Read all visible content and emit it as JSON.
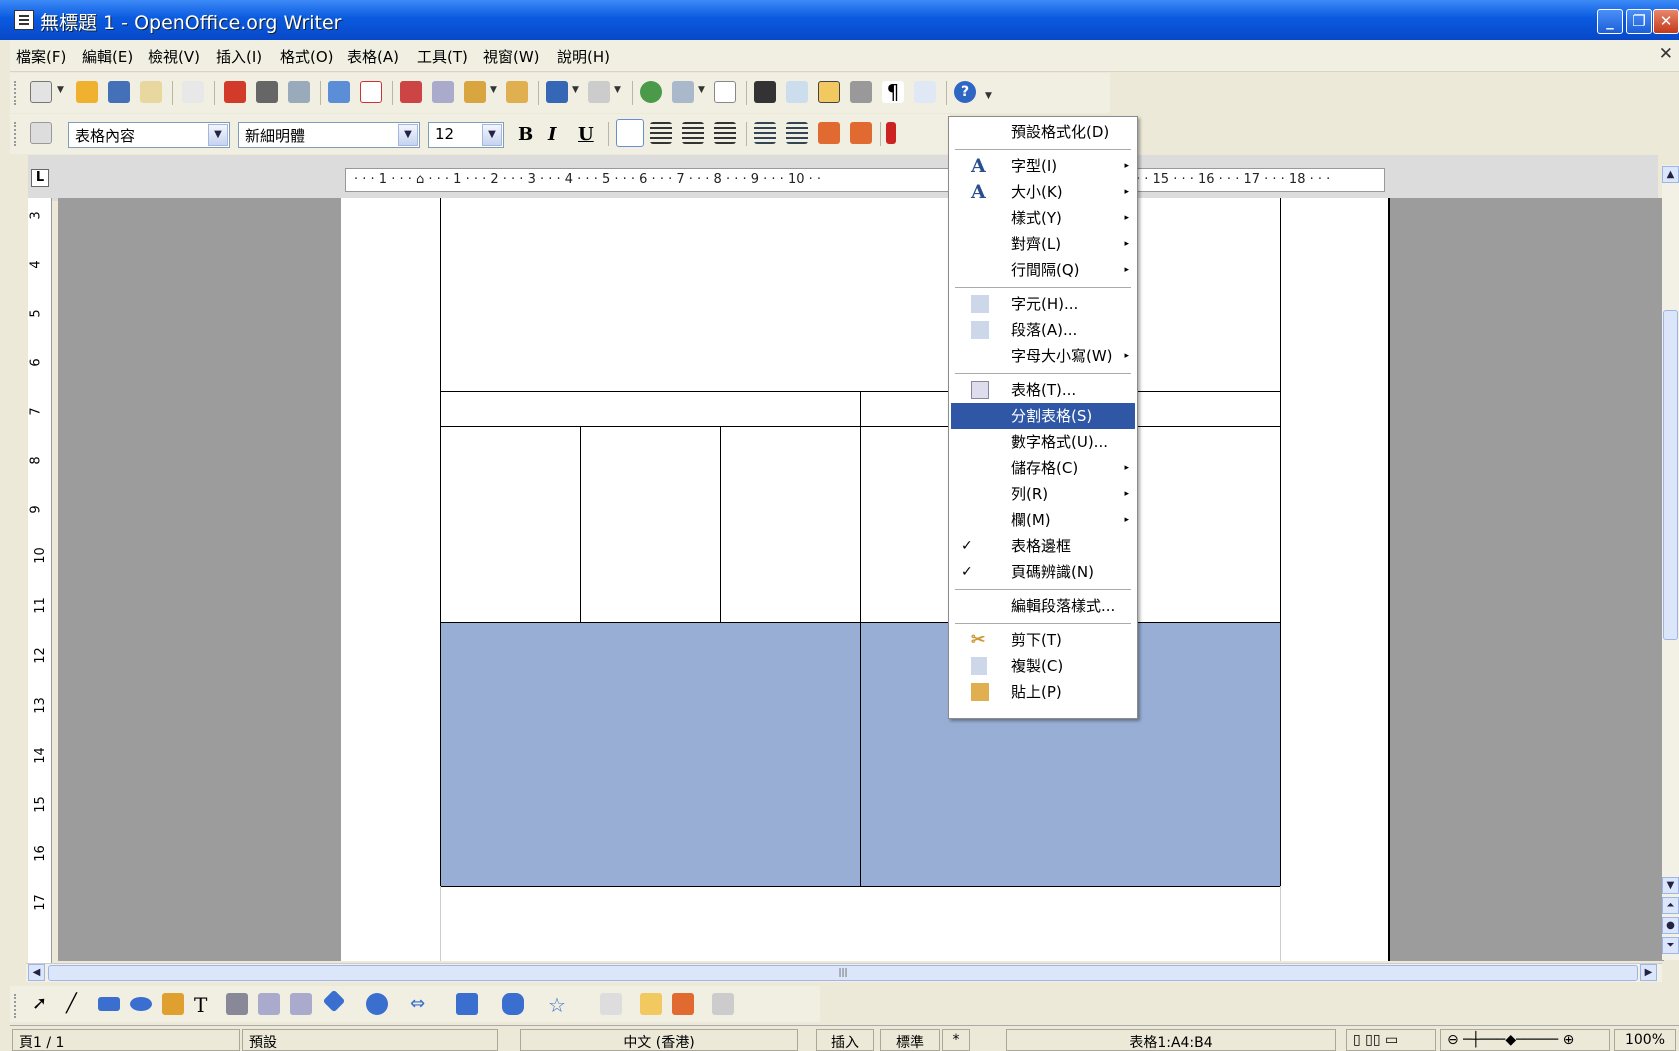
{
  "window": {
    "title": "無標題 1 - OpenOffice.org Writer"
  },
  "menubar": [
    "檔案(F)",
    "編輯(E)",
    "檢視(V)",
    "插入(I)",
    "格式(O)",
    "表格(A)",
    "工具(T)",
    "視窗(W)",
    "說明(H)"
  ],
  "formatting": {
    "style": "表格內容",
    "font": "新細明體",
    "size": "12",
    "bold": "B",
    "italic": "I",
    "underline": "U"
  },
  "ruler": {
    "h": "· · · 1 · · · ⌂ · · · 1 · · · 2 · · · 3 · · · 4 · · · 5 · · · 6 · · · 7 · · · 8 · · · 9 · · · 10 · ·",
    "h2": "· · 15 · · · 16 · · · 17 · · · 18 · · ·",
    "tab": "L",
    "v": [
      "3",
      "4",
      "5",
      "6",
      "7",
      "8",
      "9",
      "10",
      "11",
      "12",
      "13",
      "14",
      "15",
      "16",
      "17"
    ]
  },
  "context_menu": {
    "items": [
      {
        "label": "預設格式化(D)"
      },
      {
        "label": "字型(I)",
        "sub": "▸",
        "icon": "A"
      },
      {
        "label": "大小(K)",
        "sub": "▸",
        "icon": "A"
      },
      {
        "label": "樣式(Y)",
        "sub": "▸"
      },
      {
        "label": "對齊(L)",
        "sub": "▸"
      },
      {
        "label": "行間隔(Q)",
        "sub": "▸"
      },
      {
        "label": "字元(H)..."
      },
      {
        "label": "段落(A)..."
      },
      {
        "label": "字母大小寫(W)",
        "sub": "▸"
      },
      {
        "label": "表格(T)..."
      },
      {
        "label": "分割表格(S)"
      },
      {
        "label": "數字格式(U)..."
      },
      {
        "label": "儲存格(C)",
        "sub": "▸"
      },
      {
        "label": "列(R)",
        "sub": "▸"
      },
      {
        "label": "欄(M)",
        "sub": "▸"
      },
      {
        "label": "表格邊框",
        "check": "✓"
      },
      {
        "label": "頁碼辨識(N)",
        "check": "✓"
      },
      {
        "label": "編輯段落樣式..."
      },
      {
        "label": "剪下(T)"
      },
      {
        "label": "複製(C)"
      },
      {
        "label": "貼上(P)"
      }
    ]
  },
  "status": {
    "page": "頁1 / 1",
    "style": "預設",
    "lang": "中文 (香港)",
    "mode": "插入",
    "sel": "標準",
    "mod": "*",
    "cell": "表格1:A4:B4",
    "zoom": "100%"
  }
}
